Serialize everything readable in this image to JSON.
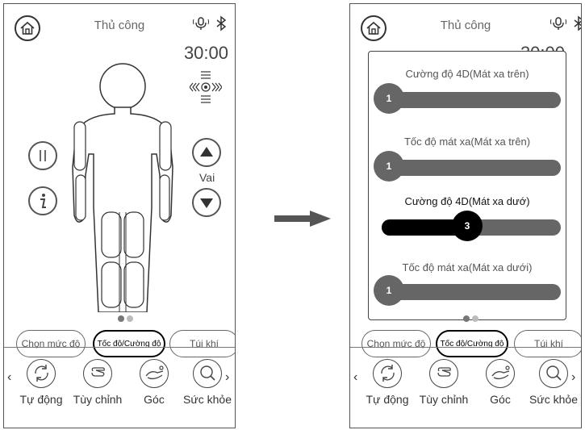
{
  "header": {
    "title": "Thủ công",
    "timer": "30:00"
  },
  "icons": {
    "home": "home-icon",
    "voice": "microphone-icon",
    "bluetooth": "bluetooth-icon"
  },
  "left": {
    "position_label": "Vai",
    "page_dots": {
      "total": 2,
      "active": 0
    }
  },
  "bottom_tabs": [
    {
      "label": "Chọn mức độ",
      "active": false
    },
    {
      "label": "Tốc độ/Cường độ",
      "active": true
    },
    {
      "label": "Túi khí",
      "active": false
    }
  ],
  "nav": [
    {
      "label": "Tự động",
      "icon": "auto-icon"
    },
    {
      "label": "Tùy chỉnh",
      "icon": "hand-icon"
    },
    {
      "label": "Góc",
      "icon": "recline-icon"
    },
    {
      "label": "Sức khỏe",
      "icon": "magnifier-icon"
    }
  ],
  "nav_arrows": {
    "prev": "‹",
    "next": "›"
  },
  "sliders": [
    {
      "label": "Cường độ 4D(Mát xa trên)",
      "value": "1",
      "fraction": 0.0,
      "active": false
    },
    {
      "label": "Tốc độ mát xa(Mát xa trên)",
      "value": "1",
      "fraction": 0.0,
      "active": false
    },
    {
      "label": "Cường độ 4D(Mát xa dướ)",
      "value": "3",
      "fraction": 0.5,
      "active": true
    },
    {
      "label": "Tốc độ mát xa(Mát xa dưới)",
      "value": "1",
      "fraction": 0.0,
      "active": false
    }
  ]
}
